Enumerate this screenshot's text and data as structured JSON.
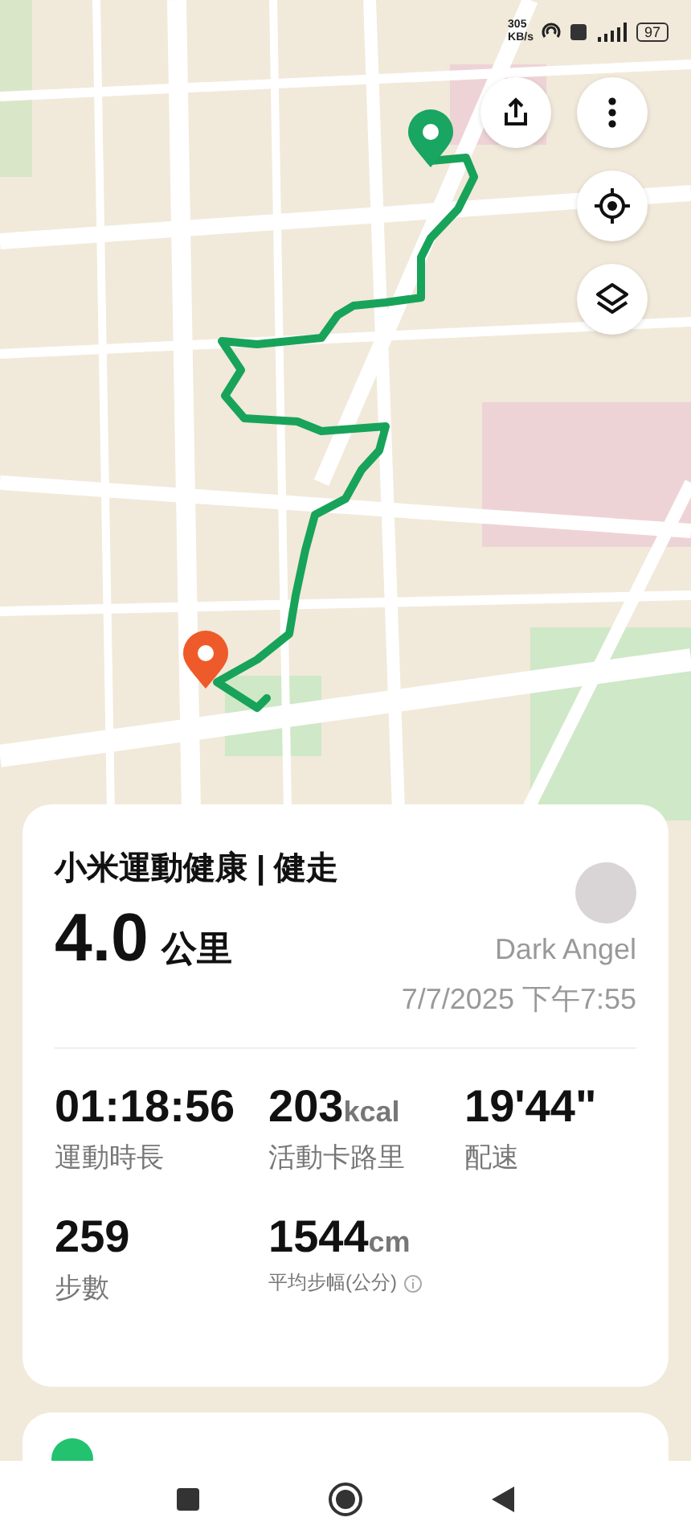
{
  "status_bar": {
    "speed": "305",
    "speed_unit": "KB/s",
    "battery": "97"
  },
  "map": {
    "buttons": [
      {
        "kind": "share"
      },
      {
        "kind": "more"
      },
      {
        "kind": "locate"
      },
      {
        "kind": "layers"
      }
    ]
  },
  "summary": {
    "title": "小米運動健康 | 健走",
    "distance": "4.0",
    "distance_unit": "公里",
    "user": "Dark Angel",
    "date": "7/7/2025 下午7:55"
  },
  "stats": [
    {
      "value": "01:18:56",
      "label": "運動時長",
      "info": false
    },
    {
      "value": "203",
      "unit": "kcal",
      "label": "活動卡路里",
      "info": false
    },
    {
      "value": "19'44\"",
      "label": "配速",
      "info": false
    },
    {
      "value": "259",
      "label": "步數",
      "info": false
    },
    {
      "value": "1544",
      "unit": "cm",
      "label": "平均步幅(公分)",
      "info": true
    }
  ],
  "nav_bar": [
    {
      "kind": "recents"
    },
    {
      "kind": "home"
    },
    {
      "kind": "back"
    }
  ]
}
